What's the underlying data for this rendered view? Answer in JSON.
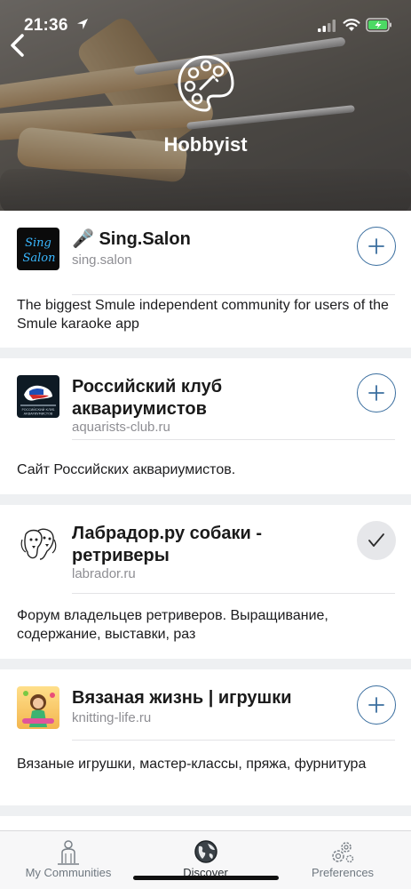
{
  "status": {
    "time": "21:36"
  },
  "header": {
    "title": "Hobbyist"
  },
  "communities": [
    {
      "name": "🎤 Sing.Salon",
      "domain": "sing.salon",
      "description": "The biggest Smule independent community for users of the Smule karaoke app",
      "logo_text": "Sing Salon",
      "followed": false
    },
    {
      "name": "Российский клуб аквариумистов",
      "domain": "aquarists-club.ru",
      "description": "Сайт Российских аквариумистов.",
      "logo_text": "РОССИЙСКИЙ КЛУБ АКВАРИУМИСТОВ",
      "followed": false
    },
    {
      "name": "Лабрадор.ру собаки - ретриверы",
      "domain": "labrador.ru",
      "description": "Форум владельцев ретриверов. Выращивание, содержание, выставки, раз",
      "followed": true
    },
    {
      "name": "Вязаная жизнь | игрушки",
      "domain": "knitting-life.ru",
      "description": "Вязаные игрушки, мастер-классы, пряжа, фурнитура",
      "followed": false
    }
  ],
  "tabs": [
    {
      "label": "My Communities",
      "icon": "person-icon"
    },
    {
      "label": "Discover",
      "icon": "globe-icon"
    },
    {
      "label": "Preferences",
      "icon": "gears-icon"
    }
  ],
  "colors": {
    "accent": "#3a6e9f",
    "background": "#eef0f2",
    "card": "#ffffff"
  }
}
